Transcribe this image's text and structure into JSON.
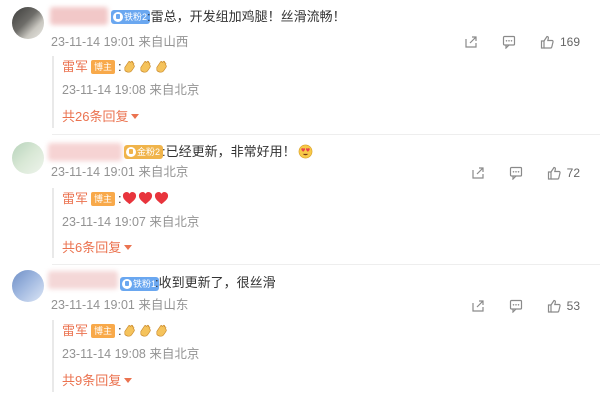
{
  "comments": [
    {
      "fan_badge": "铁粉2",
      "text": ":雷总，开发组加鸡腿！丝滑流畅！",
      "meta": "23-11-14 19:01 来自山西",
      "likes": "169",
      "reply": {
        "name": "雷军",
        "host_badge": "博主",
        "content_prefix": ":",
        "emojis": [
          "clap-emoji",
          "clap-emoji",
          "clap-emoji"
        ],
        "meta": "23-11-14 19:08 来自北京"
      },
      "more_replies": "共26条回复"
    },
    {
      "fan_badge": "金粉2",
      "text": ":已经更新，非常好用！",
      "meta": "23-11-14 19:01 来自北京",
      "likes": "72",
      "reply": {
        "name": "雷军",
        "host_badge": "博主",
        "content_prefix": ":",
        "emojis": [
          "heart-emoji",
          "heart-emoji",
          "heart-emoji"
        ],
        "meta": "23-11-14 19:07 来自北京"
      },
      "more_replies": "共6条回复"
    },
    {
      "fan_badge": "铁粉1",
      "text": ":收到更新了，很丝滑",
      "meta": "23-11-14 19:01 来自山东",
      "likes": "53",
      "reply": {
        "name": "雷军",
        "host_badge": "博主",
        "content_prefix": ":",
        "emojis": [
          "clap-emoji",
          "clap-emoji",
          "clap-emoji"
        ],
        "meta": "23-11-14 19:08 来自北京"
      },
      "more_replies": "共9条回复"
    }
  ],
  "icons": {
    "share": "share-icon",
    "comment": "comment-icon",
    "like": "thumbs-up-icon",
    "second_comment_emoji": "heart-eyes-emoji"
  },
  "colors": {
    "accent": "#eb7350",
    "host_badge": "#f8a94a",
    "fan_badge": "#6aa7f0",
    "meta_text": "#939393"
  }
}
